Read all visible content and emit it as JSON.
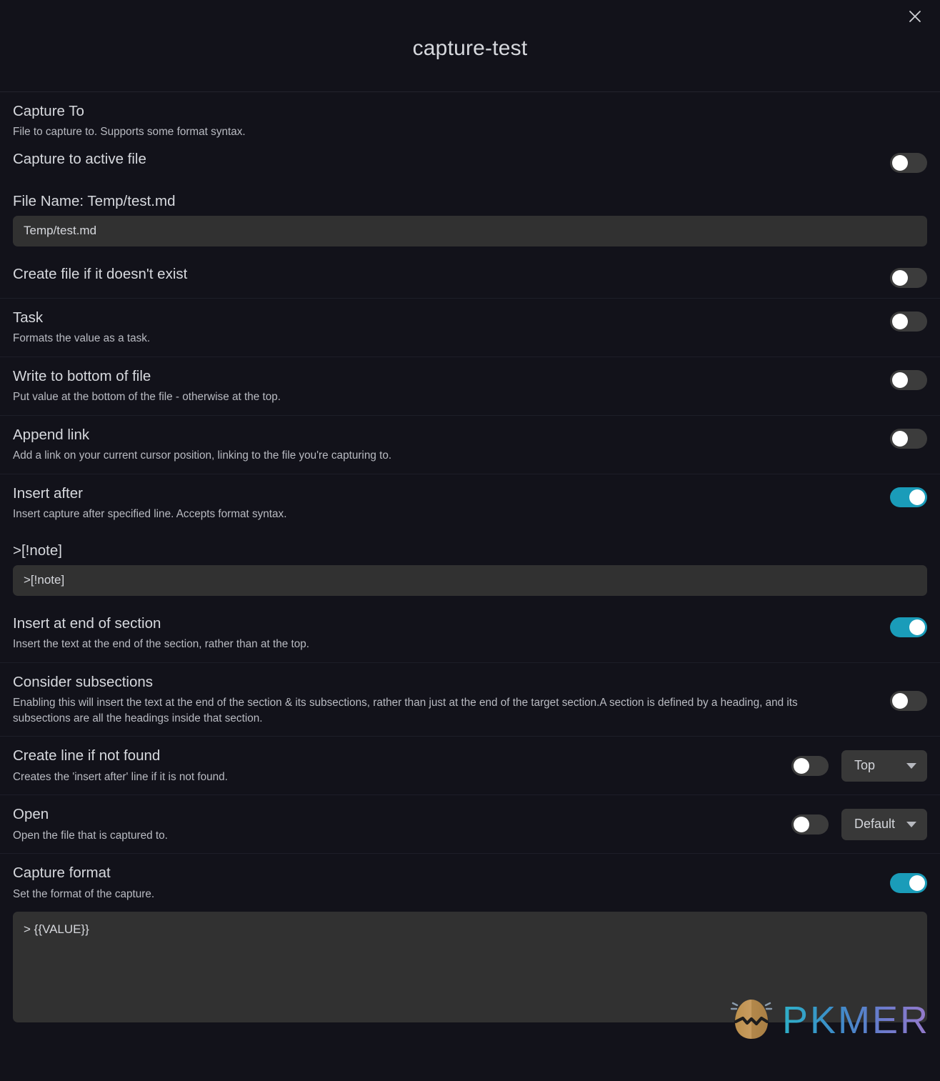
{
  "modal": {
    "title": "capture-test",
    "close_icon": "close-icon"
  },
  "settings": [
    {
      "name": "Capture To",
      "desc": "File to capture to. Supports some format syntax."
    },
    {
      "name": "Capture to active file",
      "desc": "",
      "toggle": "off"
    },
    {
      "name": "File Name: Temp/test.md",
      "input_value": "Temp/test.md",
      "input_placeholder": "Temp/test.md"
    },
    {
      "name": "Create file if it doesn't exist",
      "desc": "",
      "toggle": "off"
    },
    {
      "name": "Task",
      "desc": "Formats the value as a task.",
      "toggle": "off"
    },
    {
      "name": "Write to bottom of file",
      "desc": "Put value at the bottom of the file - otherwise at the top.",
      "toggle": "off"
    },
    {
      "name": "Append link",
      "desc": "Add a link on your current cursor position, linking to the file you're capturing to.",
      "toggle": "off"
    },
    {
      "name": "Insert after",
      "desc": "Insert capture after specified line. Accepts format syntax.",
      "toggle": "on"
    },
    {
      "name": ">[!note]",
      "input_value": ">[!note]",
      "input_placeholder": ">[!note]"
    },
    {
      "name": "Insert at end of section",
      "desc": "Insert the text at the end of the section, rather than at the top.",
      "toggle": "on"
    },
    {
      "name": "Consider subsections",
      "desc": "Enabling this will insert the text at the end of the section & its subsections, rather than just at the end of the target section.A section is defined by a heading, and its subsections are all the headings inside that section.",
      "toggle": "off"
    },
    {
      "name": "Create line if not found",
      "desc": "Creates the 'insert after' line if it is not found.",
      "toggle": "off",
      "dropdown_value": "Top"
    },
    {
      "name": "Open",
      "desc": "Open the file that is captured to.",
      "toggle": "off",
      "dropdown_value": "Default"
    },
    {
      "name": "Capture format",
      "desc": "Set the format of the capture.",
      "toggle": "on"
    },
    {
      "name": "capture-format-textarea",
      "textarea_value": "> {{VALUE}}"
    }
  ],
  "watermark": {
    "text": "PKMER",
    "icon": "pkmer-egg-logo-icon"
  },
  "colors": {
    "background": "#12121a",
    "toggle_on": "#1a9cb9",
    "toggle_off": "#3c3c3c",
    "input_bg": "#313131",
    "divider": "#1d1e28",
    "text_primary": "#d7d9de",
    "text_secondary": "#b9bbc2"
  }
}
